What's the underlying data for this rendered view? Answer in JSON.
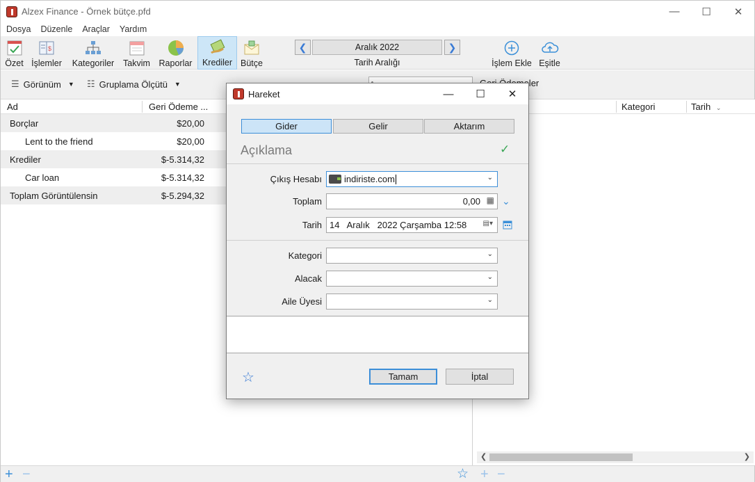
{
  "window": {
    "title": "Alzex Finance - Örnek bütçe.pfd",
    "minimize": "—",
    "maximize": "☐",
    "close": "✕"
  },
  "menu": [
    "Dosya",
    "Düzenle",
    "Araçlar",
    "Yardım"
  ],
  "toolbar": {
    "items": [
      {
        "label": "Özet",
        "icon": "summary-icon"
      },
      {
        "label": "İşlemler",
        "icon": "transactions-icon"
      },
      {
        "label": "Kategoriler",
        "icon": "categories-icon"
      },
      {
        "label": "Takvim",
        "icon": "calendar-icon"
      },
      {
        "label": "Raporlar",
        "icon": "pie-chart-icon"
      },
      {
        "label": "Krediler",
        "icon": "loans-icon"
      },
      {
        "label": "Bütçe",
        "icon": "budget-icon"
      }
    ],
    "active": "Krediler",
    "period": "Aralık 2022",
    "period_caption": "Tarih Aralığı",
    "add_label": "İşlem Ekle",
    "sync_label": "Eşitle"
  },
  "subbar": {
    "view_label": "Görünüm",
    "group_label": "Gruplama Ölçütü",
    "search_placeholder": "Arama",
    "right_title": "Geri Ödemeler"
  },
  "left_table": {
    "headers": {
      "name": "Ad",
      "repayment": "Geri Ödeme ..."
    },
    "rows": [
      {
        "label": "Borçlar",
        "amount": "$20,00",
        "indent": false,
        "shaded": true
      },
      {
        "label": "Lent to the friend",
        "amount": "$20,00",
        "indent": true,
        "shaded": false
      },
      {
        "label": "Krediler",
        "amount": "$-5.314,32",
        "indent": false,
        "shaded": true
      },
      {
        "label": "Car loan",
        "amount": "$-5.314,32",
        "indent": true,
        "shaded": false
      },
      {
        "label": "Toplam Görüntülensin",
        "amount": "$-5.294,32",
        "indent": false,
        "shaded": true
      }
    ]
  },
  "right_table": {
    "headers": {
      "category": "Kategori",
      "date": "Tarih"
    }
  },
  "dialog": {
    "title": "Hareket",
    "tabs": [
      "Gider",
      "Gelir",
      "Aktarım"
    ],
    "active_tab": "Gider",
    "description_placeholder": "Açıklama",
    "labels": {
      "account": "Çıkış Hesabı",
      "total": "Toplam",
      "date": "Tarih",
      "category": "Kategori",
      "payee": "Alacak",
      "family": "Aile Üyesi"
    },
    "values": {
      "account": "indiriste.com",
      "total": "0,00",
      "date": "14   Aralık   2022 Çarşamba 12:58",
      "category": "",
      "payee": "",
      "family": ""
    },
    "ok_label": "Tamam",
    "cancel_label": "İptal"
  },
  "colors": {
    "accent": "#3c8ed8",
    "active_tab_bg": "#cce4f7",
    "check_green": "#3aa655"
  }
}
